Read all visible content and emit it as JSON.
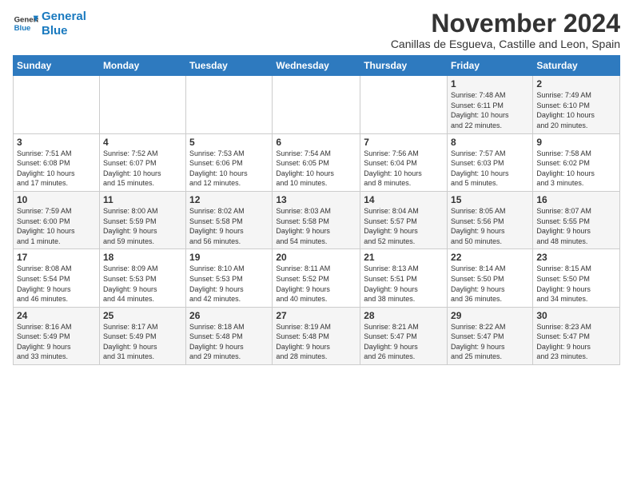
{
  "logo": {
    "line1": "General",
    "line2": "Blue"
  },
  "title": "November 2024",
  "subtitle": "Canillas de Esgueva, Castille and Leon, Spain",
  "days_header": [
    "Sunday",
    "Monday",
    "Tuesday",
    "Wednesday",
    "Thursday",
    "Friday",
    "Saturday"
  ],
  "weeks": [
    [
      {
        "day": "",
        "info": ""
      },
      {
        "day": "",
        "info": ""
      },
      {
        "day": "",
        "info": ""
      },
      {
        "day": "",
        "info": ""
      },
      {
        "day": "",
        "info": ""
      },
      {
        "day": "1",
        "info": "Sunrise: 7:48 AM\nSunset: 6:11 PM\nDaylight: 10 hours\nand 22 minutes."
      },
      {
        "day": "2",
        "info": "Sunrise: 7:49 AM\nSunset: 6:10 PM\nDaylight: 10 hours\nand 20 minutes."
      }
    ],
    [
      {
        "day": "3",
        "info": "Sunrise: 7:51 AM\nSunset: 6:08 PM\nDaylight: 10 hours\nand 17 minutes."
      },
      {
        "day": "4",
        "info": "Sunrise: 7:52 AM\nSunset: 6:07 PM\nDaylight: 10 hours\nand 15 minutes."
      },
      {
        "day": "5",
        "info": "Sunrise: 7:53 AM\nSunset: 6:06 PM\nDaylight: 10 hours\nand 12 minutes."
      },
      {
        "day": "6",
        "info": "Sunrise: 7:54 AM\nSunset: 6:05 PM\nDaylight: 10 hours\nand 10 minutes."
      },
      {
        "day": "7",
        "info": "Sunrise: 7:56 AM\nSunset: 6:04 PM\nDaylight: 10 hours\nand 8 minutes."
      },
      {
        "day": "8",
        "info": "Sunrise: 7:57 AM\nSunset: 6:03 PM\nDaylight: 10 hours\nand 5 minutes."
      },
      {
        "day": "9",
        "info": "Sunrise: 7:58 AM\nSunset: 6:02 PM\nDaylight: 10 hours\nand 3 minutes."
      }
    ],
    [
      {
        "day": "10",
        "info": "Sunrise: 7:59 AM\nSunset: 6:00 PM\nDaylight: 10 hours\nand 1 minute."
      },
      {
        "day": "11",
        "info": "Sunrise: 8:00 AM\nSunset: 5:59 PM\nDaylight: 9 hours\nand 59 minutes."
      },
      {
        "day": "12",
        "info": "Sunrise: 8:02 AM\nSunset: 5:58 PM\nDaylight: 9 hours\nand 56 minutes."
      },
      {
        "day": "13",
        "info": "Sunrise: 8:03 AM\nSunset: 5:58 PM\nDaylight: 9 hours\nand 54 minutes."
      },
      {
        "day": "14",
        "info": "Sunrise: 8:04 AM\nSunset: 5:57 PM\nDaylight: 9 hours\nand 52 minutes."
      },
      {
        "day": "15",
        "info": "Sunrise: 8:05 AM\nSunset: 5:56 PM\nDaylight: 9 hours\nand 50 minutes."
      },
      {
        "day": "16",
        "info": "Sunrise: 8:07 AM\nSunset: 5:55 PM\nDaylight: 9 hours\nand 48 minutes."
      }
    ],
    [
      {
        "day": "17",
        "info": "Sunrise: 8:08 AM\nSunset: 5:54 PM\nDaylight: 9 hours\nand 46 minutes."
      },
      {
        "day": "18",
        "info": "Sunrise: 8:09 AM\nSunset: 5:53 PM\nDaylight: 9 hours\nand 44 minutes."
      },
      {
        "day": "19",
        "info": "Sunrise: 8:10 AM\nSunset: 5:53 PM\nDaylight: 9 hours\nand 42 minutes."
      },
      {
        "day": "20",
        "info": "Sunrise: 8:11 AM\nSunset: 5:52 PM\nDaylight: 9 hours\nand 40 minutes."
      },
      {
        "day": "21",
        "info": "Sunrise: 8:13 AM\nSunset: 5:51 PM\nDaylight: 9 hours\nand 38 minutes."
      },
      {
        "day": "22",
        "info": "Sunrise: 8:14 AM\nSunset: 5:50 PM\nDaylight: 9 hours\nand 36 minutes."
      },
      {
        "day": "23",
        "info": "Sunrise: 8:15 AM\nSunset: 5:50 PM\nDaylight: 9 hours\nand 34 minutes."
      }
    ],
    [
      {
        "day": "24",
        "info": "Sunrise: 8:16 AM\nSunset: 5:49 PM\nDaylight: 9 hours\nand 33 minutes."
      },
      {
        "day": "25",
        "info": "Sunrise: 8:17 AM\nSunset: 5:49 PM\nDaylight: 9 hours\nand 31 minutes."
      },
      {
        "day": "26",
        "info": "Sunrise: 8:18 AM\nSunset: 5:48 PM\nDaylight: 9 hours\nand 29 minutes."
      },
      {
        "day": "27",
        "info": "Sunrise: 8:19 AM\nSunset: 5:48 PM\nDaylight: 9 hours\nand 28 minutes."
      },
      {
        "day": "28",
        "info": "Sunrise: 8:21 AM\nSunset: 5:47 PM\nDaylight: 9 hours\nand 26 minutes."
      },
      {
        "day": "29",
        "info": "Sunrise: 8:22 AM\nSunset: 5:47 PM\nDaylight: 9 hours\nand 25 minutes."
      },
      {
        "day": "30",
        "info": "Sunrise: 8:23 AM\nSunset: 5:47 PM\nDaylight: 9 hours\nand 23 minutes."
      }
    ]
  ]
}
